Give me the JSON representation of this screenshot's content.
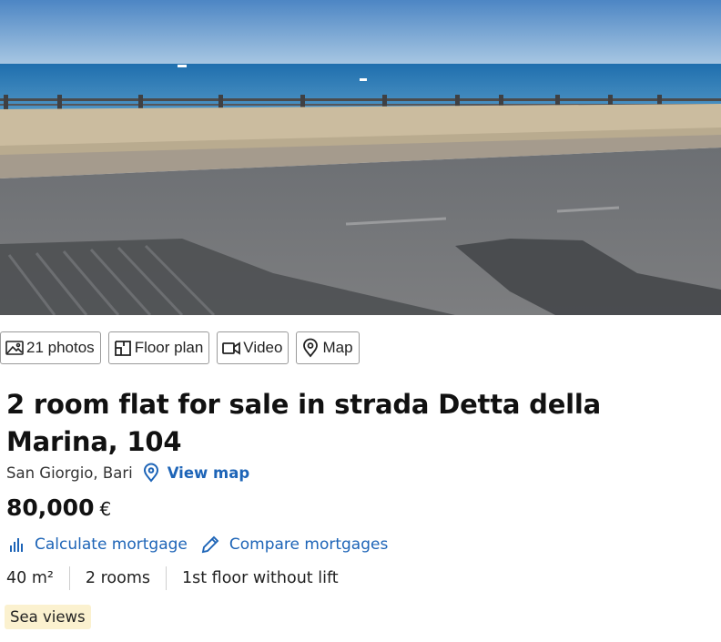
{
  "photo": {
    "alt": "Sea view from seafront road"
  },
  "media_buttons": [
    {
      "label": "21 photos",
      "icon": "image-icon"
    },
    {
      "label": "Floor plan",
      "icon": "floor-plan-icon"
    },
    {
      "label": "Video",
      "icon": "video-icon"
    },
    {
      "label": "Map",
      "icon": "map-pin-icon"
    }
  ],
  "listing": {
    "title": "2 room flat for sale in strada Detta della Marina, 104",
    "location": "San Giorgio, Bari",
    "view_map_label": "View map",
    "price": "80,000",
    "currency": "€"
  },
  "mortgage": {
    "calculate_label": "Calculate mortgage",
    "compare_label": "Compare mortgages"
  },
  "features": [
    "40 m²",
    "2 rooms",
    "1st floor without lift"
  ],
  "tags": [
    "Sea views"
  ],
  "colors": {
    "link": "#1d64b7",
    "tag_bg": "#fbf1cf",
    "border": "#9a9a9a"
  }
}
